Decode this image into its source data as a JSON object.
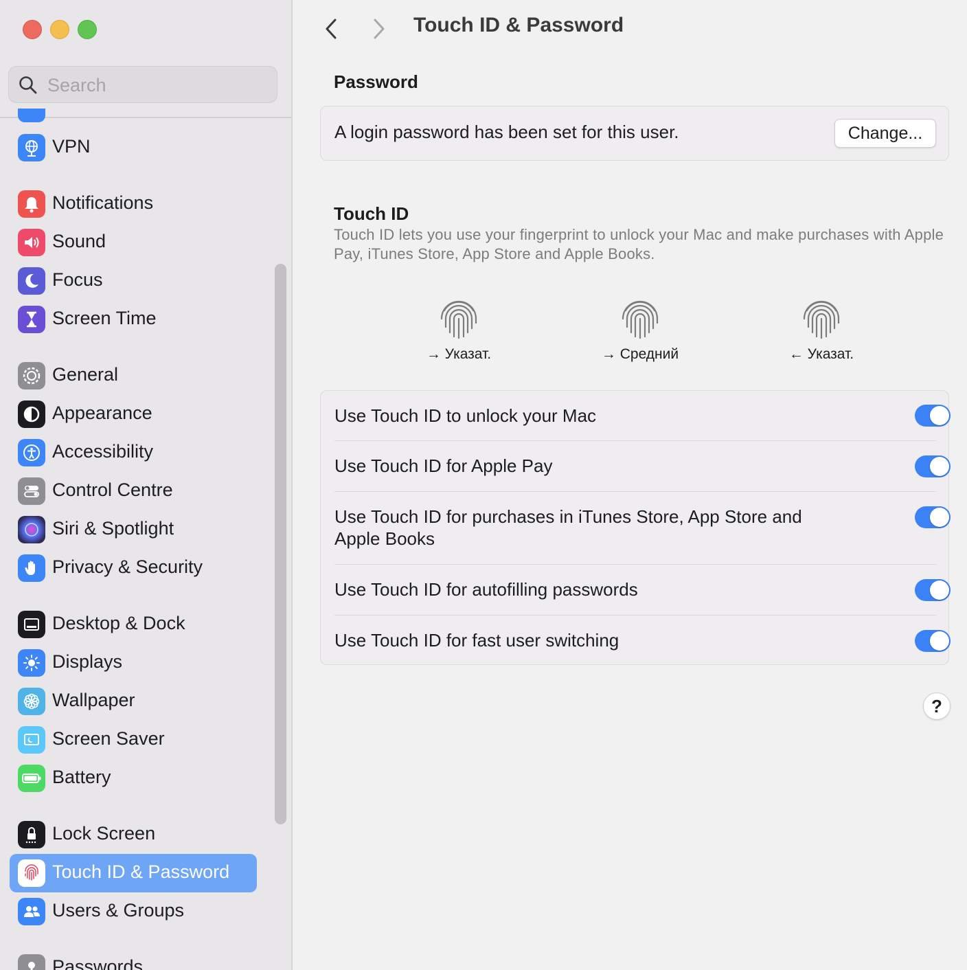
{
  "window": {
    "title": "Touch ID & Password"
  },
  "search": {
    "placeholder": "Search"
  },
  "sidebar": {
    "items": [
      {
        "label": "VPN",
        "icon": "globe-icon",
        "color": "#3d86f7"
      },
      {
        "label": "Notifications",
        "icon": "bell-icon",
        "color": "#ef5350"
      },
      {
        "label": "Sound",
        "icon": "speaker-icon",
        "color": "#ee4b6a"
      },
      {
        "label": "Focus",
        "icon": "moon-icon",
        "color": "#5b5bd6"
      },
      {
        "label": "Screen Time",
        "icon": "hourglass-icon",
        "color": "#6a4fd6"
      },
      {
        "label": "General",
        "icon": "gear-icon",
        "color": "#8e8e93"
      },
      {
        "label": "Appearance",
        "icon": "appearance-icon",
        "color": "#1c1c1e"
      },
      {
        "label": "Accessibility",
        "icon": "accessibility-icon",
        "color": "#3d86f7"
      },
      {
        "label": "Control Centre",
        "icon": "switches-icon",
        "color": "#8e8e93"
      },
      {
        "label": "Siri & Spotlight",
        "icon": "siri-icon",
        "color": "#2c2c54"
      },
      {
        "label": "Privacy & Security",
        "icon": "hand-icon",
        "color": "#3d86f7"
      },
      {
        "label": "Desktop & Dock",
        "icon": "dock-icon",
        "color": "#1c1c1e"
      },
      {
        "label": "Displays",
        "icon": "sun-icon",
        "color": "#3d86f7"
      },
      {
        "label": "Wallpaper",
        "icon": "flower-icon",
        "color": "#4fb3e8"
      },
      {
        "label": "Screen Saver",
        "icon": "screensaver-icon",
        "color": "#5ac8fa"
      },
      {
        "label": "Battery",
        "icon": "battery-icon",
        "color": "#4cd964"
      },
      {
        "label": "Lock Screen",
        "icon": "lock-icon",
        "color": "#1c1c1e"
      },
      {
        "label": "Touch ID & Password",
        "icon": "fingerprint-icon",
        "color": "#ffffff",
        "selected": true
      },
      {
        "label": "Users & Groups",
        "icon": "users-icon",
        "color": "#3d86f7"
      },
      {
        "label": "Passwords",
        "icon": "key-icon",
        "color": "#8e8e93"
      }
    ]
  },
  "main": {
    "title": "Touch ID & Password",
    "password_section": {
      "title": "Password",
      "text": "A login password has been set for this user.",
      "change_label": "Change..."
    },
    "touchid_section": {
      "title": "Touch ID",
      "description": "Touch ID lets you use your fingerprint to unlock your Mac and make purchases with Apple Pay, iTunes Store, App Store and Apple Books.",
      "fingerprints": [
        {
          "label": "→ Указат."
        },
        {
          "label": "→ Средний"
        },
        {
          "label": "← Указат."
        }
      ],
      "options": [
        {
          "label": "Use Touch ID to unlock your Mac",
          "enabled": true
        },
        {
          "label": "Use Touch ID for Apple Pay",
          "enabled": true
        },
        {
          "label": "Use Touch ID for purchases in iTunes Store, App Store and Apple Books",
          "enabled": true
        },
        {
          "label": "Use Touch ID for autofilling passwords",
          "enabled": true
        },
        {
          "label": "Use Touch ID for fast user switching",
          "enabled": true
        }
      ]
    },
    "help_label": "?"
  },
  "colors": {
    "accent": "#3b82f6",
    "selection": "#6ea5f4"
  }
}
